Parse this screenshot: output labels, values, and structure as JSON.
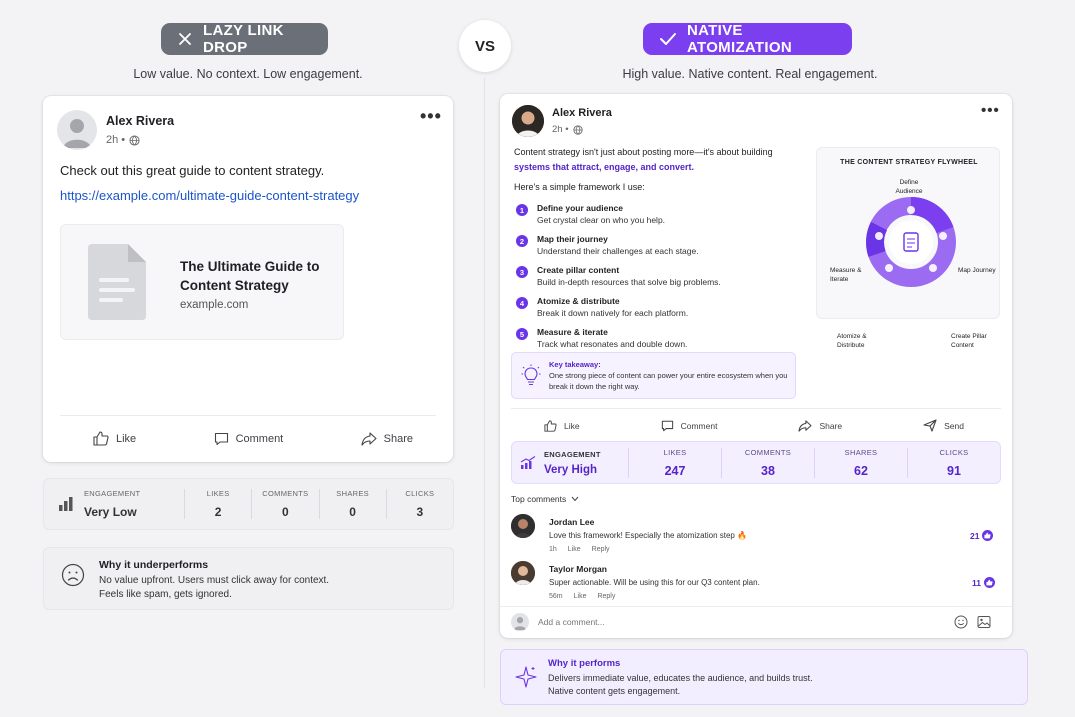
{
  "header": {
    "lazy_label": "LAZY LINK DROP",
    "vs_label": "VS",
    "native_label": "NATIVE ATOMIZATION",
    "lazy_subtitle": "Low value. No context. Low engagement.",
    "native_subtitle": "High value. Native content. Real engagement."
  },
  "colors": {
    "accent": "#7b3ff0",
    "lazy_gray": "#6b7078",
    "link_blue": "#1a55c9"
  },
  "lazy_post": {
    "author": "Alex Rivera",
    "time": "2h •",
    "text": "Check out this great guide to content strategy.",
    "link": "https://example.com/ultimate-guide-content-strategy",
    "preview_title": "The Ultimate Guide to Content Strategy",
    "preview_domain": "example.com",
    "actions": {
      "like": "Like",
      "comment": "Comment",
      "share": "Share"
    }
  },
  "lazy_stats": {
    "engagement_label": "ENGAGEMENT",
    "engagement_value": "Very Low",
    "items": [
      {
        "label": "LIKES",
        "value": "2"
      },
      {
        "label": "COMMENTS",
        "value": "0"
      },
      {
        "label": "SHARES",
        "value": "0"
      },
      {
        "label": "CLICKS",
        "value": "3"
      }
    ]
  },
  "lazy_why": {
    "title": "Why it underperforms",
    "line1": "No value upfront. Users must click away for context.",
    "line2": "Feels like spam, gets ignored."
  },
  "native_post": {
    "author": "Alex Rivera",
    "time": "2h •",
    "intro": "Content strategy isn't just about posting more—it's about building",
    "intro_highlight": "systems that attract, engage, and convert.",
    "framework_intro": "Here's a simple framework I use:",
    "steps": [
      {
        "num": "1",
        "title": "Define your audience",
        "desc": "Get crystal clear on who you help."
      },
      {
        "num": "2",
        "title": "Map their journey",
        "desc": "Understand their challenges at each stage."
      },
      {
        "num": "3",
        "title": "Create pillar content",
        "desc": "Build in-depth resources that solve big problems."
      },
      {
        "num": "4",
        "title": "Atomize & distribute",
        "desc": "Break it down natively for each platform."
      },
      {
        "num": "5",
        "title": "Measure & iterate",
        "desc": "Track what resonates and double down."
      }
    ],
    "takeaway_title": "Key takeaway:",
    "takeaway_text": "One strong piece of content can power your entire ecosystem when you break it down the right way.",
    "flywheel": {
      "title": "THE CONTENT STRATEGY FLYWHEEL",
      "define": "Define Audience",
      "map": "Map Journey",
      "create": "Create Pillar Content",
      "atomize": "Atomize & Distribute",
      "measure": "Measure & Iterate"
    },
    "actions": {
      "like": "Like",
      "comment": "Comment",
      "share": "Share",
      "send": "Send"
    }
  },
  "native_stats": {
    "engagement_label": "ENGAGEMENT",
    "engagement_value": "Very High",
    "items": [
      {
        "label": "LIKES",
        "value": "247"
      },
      {
        "label": "COMMENTS",
        "value": "38"
      },
      {
        "label": "SHARES",
        "value": "62"
      },
      {
        "label": "CLICKS",
        "value": "91"
      }
    ]
  },
  "comments": {
    "header": "Top comments",
    "list": [
      {
        "name": "Jordan Lee",
        "text": "Love this framework! Especially the atomization step 🔥",
        "time": "1h",
        "like": "Like",
        "reply": "Reply",
        "count": "21"
      },
      {
        "name": "Taylor Morgan",
        "text": "Super actionable. Will be using this for our Q3 content plan.",
        "time": "56m",
        "like": "Like",
        "reply": "Reply",
        "count": "11"
      }
    ],
    "add_placeholder": "Add a comment..."
  },
  "native_why": {
    "title": "Why it performs",
    "line1": "Delivers immediate value, educates the audience, and builds trust.",
    "line2": "Native content gets engagement."
  }
}
